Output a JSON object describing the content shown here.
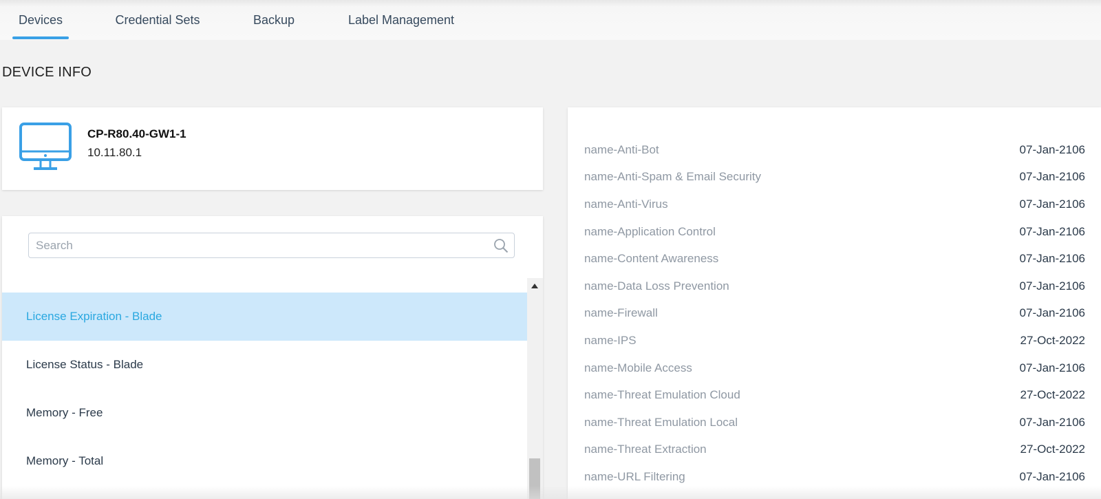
{
  "tabs": [
    {
      "label": "Devices",
      "active": true
    },
    {
      "label": "Credential Sets",
      "active": false
    },
    {
      "label": "Backup",
      "active": false
    },
    {
      "label": "Label Management",
      "active": false
    }
  ],
  "page": {
    "heading": "DEVICE INFO"
  },
  "device": {
    "name": "CP-R80.40-GW1-1",
    "ip": "10.11.80.1",
    "icon": "monitor-icon"
  },
  "metrics": {
    "search_placeholder": "Search",
    "items": [
      {
        "label": "License Expiration - Blade",
        "selected": true
      },
      {
        "label": "License Status - Blade",
        "selected": false
      },
      {
        "label": "Memory - Free",
        "selected": false
      },
      {
        "label": "Memory - Total",
        "selected": false
      }
    ]
  },
  "licenses": [
    {
      "name": "name-Anti-Bot",
      "date": "07-Jan-2106"
    },
    {
      "name": "name-Anti-Spam & Email Security",
      "date": "07-Jan-2106"
    },
    {
      "name": "name-Anti-Virus",
      "date": "07-Jan-2106"
    },
    {
      "name": "name-Application Control",
      "date": "07-Jan-2106"
    },
    {
      "name": "name-Content Awareness",
      "date": "07-Jan-2106"
    },
    {
      "name": "name-Data Loss Prevention",
      "date": "07-Jan-2106"
    },
    {
      "name": "name-Firewall",
      "date": "07-Jan-2106"
    },
    {
      "name": "name-IPS",
      "date": "27-Oct-2022"
    },
    {
      "name": "name-Mobile Access",
      "date": "07-Jan-2106"
    },
    {
      "name": "name-Threat Emulation Cloud",
      "date": "27-Oct-2022"
    },
    {
      "name": "name-Threat Emulation Local",
      "date": "07-Jan-2106"
    },
    {
      "name": "name-Threat Extraction",
      "date": "27-Oct-2022"
    },
    {
      "name": "name-URL Filtering",
      "date": "07-Jan-2106"
    }
  ],
  "colors": {
    "accent": "#3aa0e6",
    "selected_bg": "#cde8fb",
    "selected_text": "#2aa8e0",
    "background": "#f2f2f2"
  }
}
